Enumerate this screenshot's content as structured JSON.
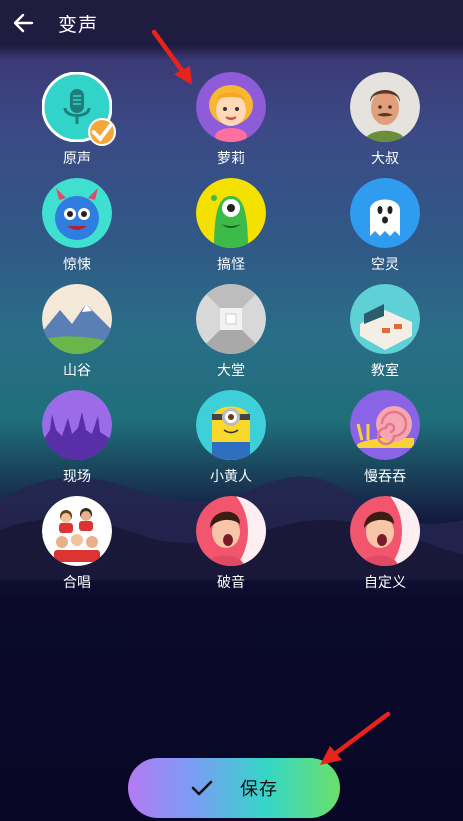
{
  "header": {
    "back_icon": "arrow-left-icon",
    "title": "变声"
  },
  "voices": [
    {
      "label": "原声",
      "icon": "microphone-icon",
      "selected": true
    },
    {
      "label": "萝莉",
      "icon": "girl-icon"
    },
    {
      "label": "大叔",
      "icon": "uncle-icon"
    },
    {
      "label": "惊悚",
      "icon": "monster-icon"
    },
    {
      "label": "搞怪",
      "icon": "alien-icon"
    },
    {
      "label": "空灵",
      "icon": "ghost-icon"
    },
    {
      "label": "山谷",
      "icon": "mountain-icon"
    },
    {
      "label": "大堂",
      "icon": "hall-icon"
    },
    {
      "label": "教室",
      "icon": "classroom-icon"
    },
    {
      "label": "现场",
      "icon": "concert-icon"
    },
    {
      "label": "小黄人",
      "icon": "minion-icon"
    },
    {
      "label": "慢吞吞",
      "icon": "snail-icon"
    },
    {
      "label": "合唱",
      "icon": "choir-icon"
    },
    {
      "label": "破音",
      "icon": "singer-icon"
    },
    {
      "label": "自定义",
      "icon": "custom-singer-icon"
    }
  ],
  "save_button": {
    "label": "保存",
    "icon": "checkmark-icon"
  },
  "colors": {
    "header_bg": "#201c40",
    "check_badge": "#f6a73a",
    "arrow": "#e8231d"
  }
}
